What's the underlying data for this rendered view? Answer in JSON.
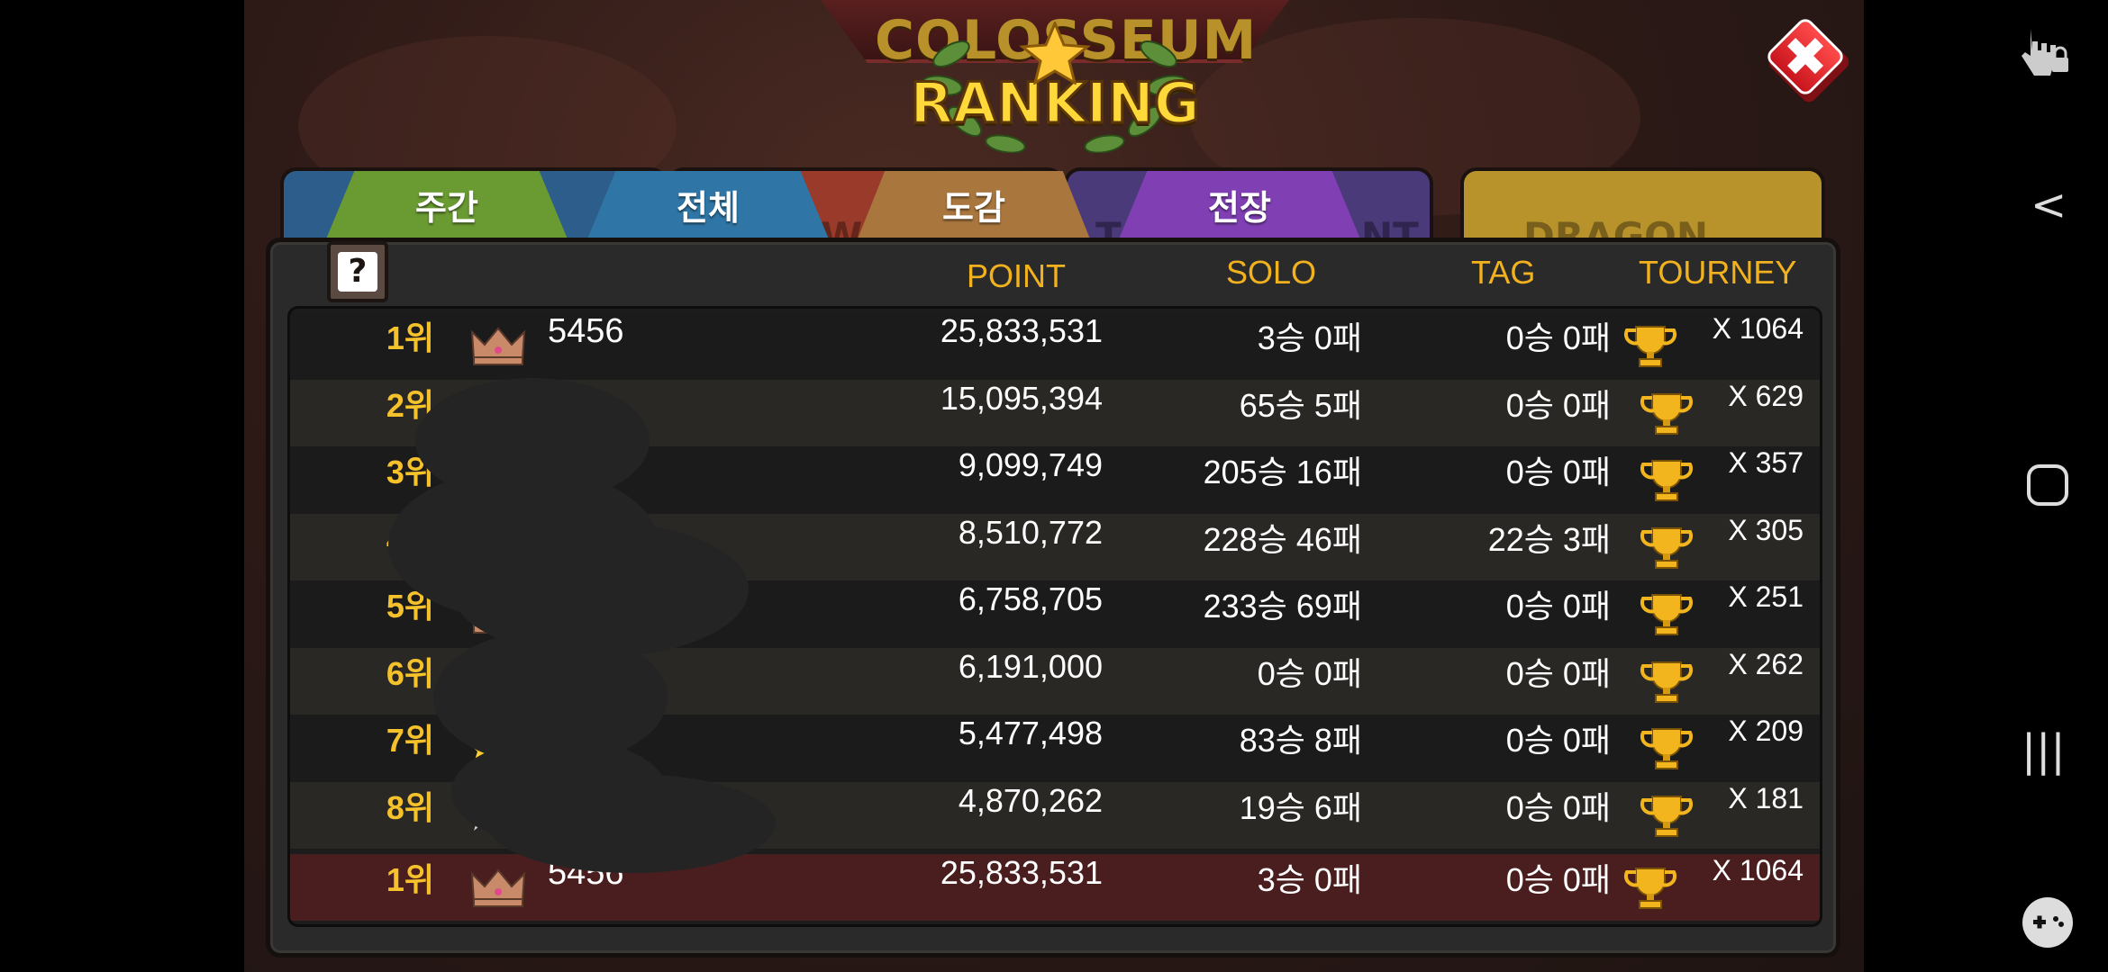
{
  "header": {
    "title_top": "COLOSSEUM",
    "title_main": "RANKING"
  },
  "close_label": "✖",
  "tabs": [
    {
      "label": "주간",
      "color": "#5f8a2a"
    },
    {
      "label": "전체",
      "color": "#2f6f98"
    },
    {
      "label": "도감",
      "color": "#9a6a34"
    },
    {
      "label": "전장",
      "color": "#7a3cab"
    }
  ],
  "ghost_text": [
    "WA",
    "TO",
    "NT",
    "DRAGON"
  ],
  "help_label": "?",
  "columns": {
    "point": "POINT",
    "solo": "SOLO",
    "tag": "TAG",
    "tourney": "TOURNEY"
  },
  "rows": [
    {
      "rank": "1위",
      "name": "5456",
      "point": "25,833,531",
      "solo": "3승 0패",
      "tag": "0승 0패",
      "tourney": "X 1064",
      "crown": "bronze-crown"
    },
    {
      "rank": "2위",
      "name": "",
      "point": "15,095,394",
      "solo": "65승 5패",
      "tag": "0승 0패",
      "tourney": "X 629",
      "crown": "silver-crown"
    },
    {
      "rank": "3위",
      "name": "",
      "point": "9,099,749",
      "solo": "205승 16패",
      "tag": "0승 0패",
      "tourney": "X 357",
      "crown": ""
    },
    {
      "rank": "4위",
      "name": "",
      "point": "8,510,772",
      "solo": "228승 46패",
      "tag": "22승 3패",
      "tourney": "X 305",
      "crown": ""
    },
    {
      "rank": "5위",
      "name": "",
      "point": "6,758,705",
      "solo": "233승 69패",
      "tag": "0승 0패",
      "tourney": "X 251",
      "crown": "bronze-crown"
    },
    {
      "rank": "6위",
      "name": "",
      "point": "6,191,000",
      "solo": "0승 0패",
      "tag": "0승 0패",
      "tourney": "X 262",
      "crown": "silver-crown"
    },
    {
      "rank": "7위",
      "name": "",
      "point": "5,477,498",
      "solo": "83승 8패",
      "tag": "0승 0패",
      "tourney": "X 209",
      "crown": "gold-stars"
    },
    {
      "rank": "8위",
      "name": "",
      "point": "4,870,262",
      "solo": "19승 6패",
      "tag": "0승 0패",
      "tourney": "X 181",
      "crown": "silver-stars"
    }
  ],
  "my_row": {
    "rank": "1위",
    "name": "5456",
    "point": "25,833,531",
    "solo": "3승 0패",
    "tag": "0승 0패",
    "tourney": "X 1064",
    "crown": "bronze-crown"
  },
  "system_nav": {
    "back": "<",
    "home": "○",
    "recents": "|||"
  }
}
